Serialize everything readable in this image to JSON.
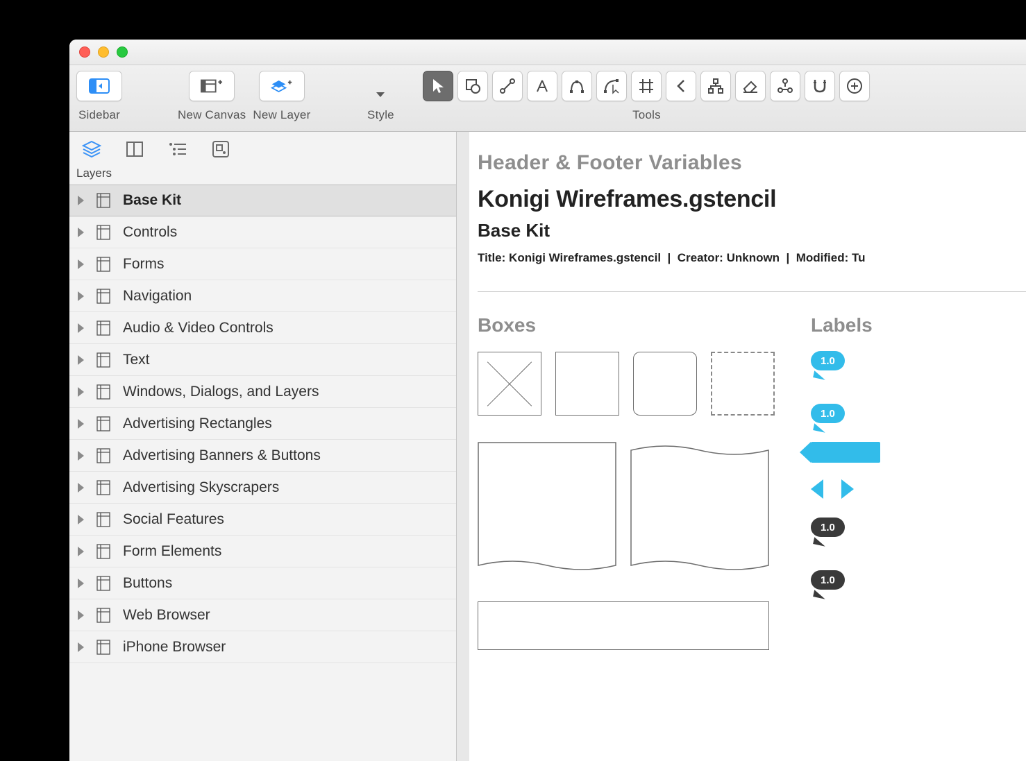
{
  "toolbar": {
    "sidebar_label": "Sidebar",
    "new_canvas_label": "New Canvas",
    "new_layer_label": "New Layer",
    "style_label": "Style",
    "tools_label": "Tools"
  },
  "sidebar": {
    "layers_label": "Layers",
    "items": [
      "Base Kit",
      "Controls",
      "Forms",
      "Navigation",
      "Audio & Video Controls",
      "Text",
      "Windows, Dialogs, and Layers",
      "Advertising Rectangles",
      "Advertising Banners & Buttons",
      "Advertising Skyscrapers",
      "Social Features",
      "Form Elements",
      "Buttons",
      "Web Browser",
      "iPhone Browser"
    ]
  },
  "canvas": {
    "hf_section": "Header & Footer Variables",
    "document_title": "Konigi Wireframes.gstencil",
    "page_name": "Base Kit",
    "meta_prefix_title": "Title:",
    "meta_title": "Konigi Wireframes.gstencil",
    "meta_prefix_creator": "Creator:",
    "meta_creator": "Unknown",
    "meta_prefix_modified": "Modified:",
    "meta_modified": "Tu",
    "boxes_label": "Boxes",
    "labels_label": "Labels",
    "label_values": [
      "1.0",
      "1.0",
      "1.0",
      "1.0"
    ]
  }
}
